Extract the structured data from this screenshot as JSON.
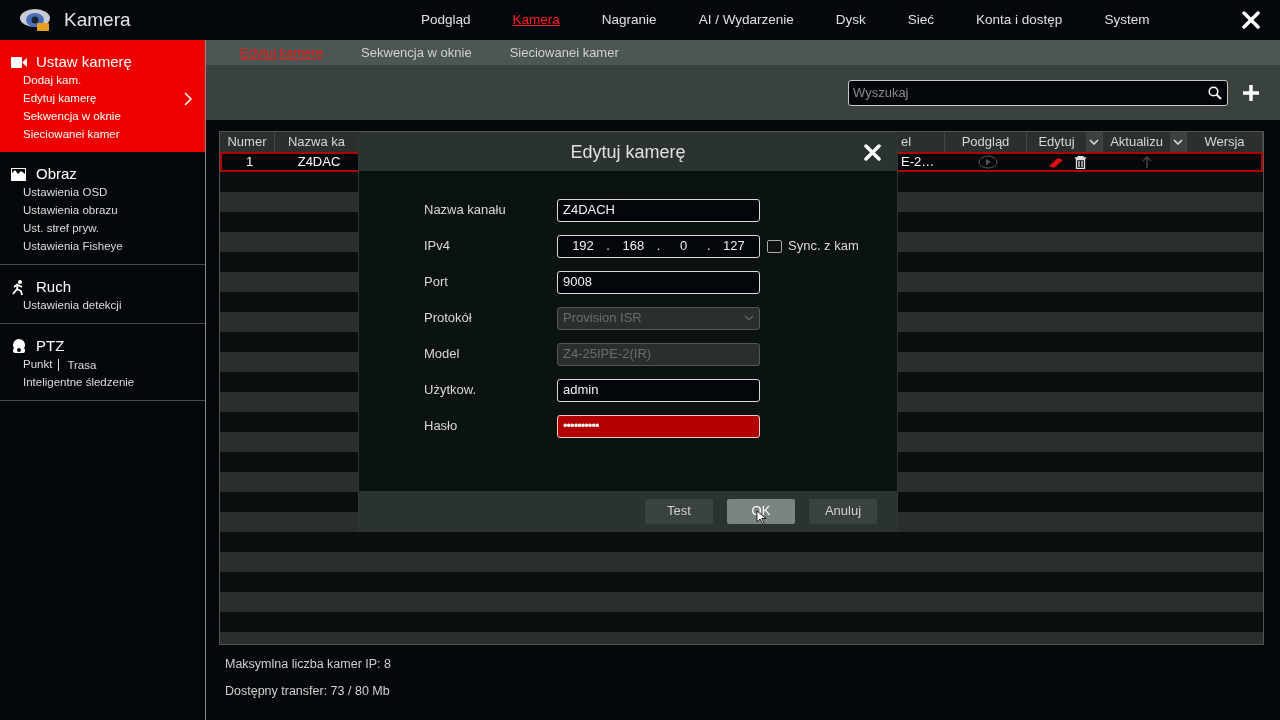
{
  "app": {
    "title": "Kamera"
  },
  "top_nav": [
    {
      "label": "Podgląd",
      "selected": false
    },
    {
      "label": "Kamera",
      "selected": true
    },
    {
      "label": "Nagranie",
      "selected": false
    },
    {
      "label": "AI / Wydarzenie",
      "selected": false
    },
    {
      "label": "Dysk",
      "selected": false
    },
    {
      "label": "Sieć",
      "selected": false
    },
    {
      "label": "Konta i dostęp",
      "selected": false
    },
    {
      "label": "System",
      "selected": false
    }
  ],
  "sidebar": {
    "sections": [
      {
        "title": "Ustaw kamerę",
        "selected": true,
        "rows": [
          [
            {
              "label": "Dodaj kam.",
              "selected": false
            }
          ],
          [
            {
              "label": "Edytuj kamerę",
              "selected": true
            }
          ],
          [
            {
              "label": "Sekwencja w oknie",
              "selected": false
            }
          ],
          [
            {
              "label": "Sieciowanei kamer",
              "selected": false
            }
          ]
        ]
      },
      {
        "title": "Obraz",
        "selected": false,
        "rows": [
          [
            {
              "label": "Ustawienia OSD",
              "selected": false
            }
          ],
          [
            {
              "label": "Ustawienia obrazu",
              "selected": false
            }
          ],
          [
            {
              "label": "Ust. stref pryw.",
              "selected": false
            }
          ],
          [
            {
              "label": "Ustawienia Fisheye",
              "selected": false
            }
          ]
        ]
      },
      {
        "title": "Ruch",
        "selected": false,
        "rows": [
          [
            {
              "label": "Ustawienia detekcji",
              "selected": false
            }
          ]
        ]
      },
      {
        "title": "PTZ",
        "selected": false,
        "rows": [
          [
            {
              "label": "Punkt",
              "selected": false
            },
            {
              "label": "Trasa",
              "selected": false
            }
          ],
          [
            {
              "label": "Inteligentne śledzenie",
              "selected": false
            }
          ]
        ]
      }
    ]
  },
  "subtabs": [
    {
      "label": "Edytuj kamerę",
      "selected": true
    },
    {
      "label": "Sekwencja w oknie",
      "selected": false
    },
    {
      "label": "Sieciowanei kamer",
      "selected": false
    }
  ],
  "search": {
    "placeholder": "Wyszukaj"
  },
  "table": {
    "columns": [
      {
        "label": "Numer",
        "kind": "text",
        "menu": false
      },
      {
        "label": "Nazwa ka",
        "kind": "text",
        "menu": false
      },
      {
        "label": "el",
        "kind": "text",
        "menu": false
      },
      {
        "label": "Podgląd",
        "kind": "preview",
        "menu": false
      },
      {
        "label": "Edytuj",
        "kind": "edit",
        "menu": true
      },
      {
        "label": "Aktualizu",
        "kind": "update",
        "menu": true
      },
      {
        "label": "Wersja",
        "kind": "version",
        "menu": false
      }
    ],
    "rows": [
      {
        "cells": [
          "1",
          "Z4DAC",
          "E-2…"
        ],
        "selected": true
      }
    ]
  },
  "info": [
    "Maksymlna liczba kamer IP: 8",
    "Dostępny transfer: 73 / 80 Mb"
  ],
  "dialog": {
    "title": "Edytuj kamerę",
    "fields": [
      {
        "label": "Nazwa kanału",
        "kind": "text",
        "value": "Z4DACH",
        "disabled": false,
        "focused": false
      },
      {
        "label": "IPv4",
        "kind": "ip",
        "octets": [
          "192",
          "168",
          "0",
          "127"
        ],
        "separator": ".",
        "disabled": false,
        "focused": false,
        "sync": {
          "label": "Sync. z kam",
          "checked": false
        }
      },
      {
        "label": "Port",
        "kind": "text",
        "value": "9008",
        "disabled": false,
        "focused": false
      },
      {
        "label": "Protokół",
        "kind": "select",
        "value": "Provision ISR",
        "disabled": true,
        "focused": false
      },
      {
        "label": "Model",
        "kind": "text",
        "value": "Z4-25IPE-2(IR)",
        "disabled": true,
        "focused": false
      },
      {
        "label": "Użytkow.",
        "kind": "text",
        "value": "admin",
        "disabled": false,
        "focused": false
      },
      {
        "label": "Hasło",
        "kind": "password",
        "value": "••••••••••",
        "disabled": false,
        "focused": true
      }
    ],
    "buttons": [
      {
        "label": "Test",
        "hovered": false
      },
      {
        "label": "OK",
        "hovered": true
      },
      {
        "label": "Anuluj",
        "hovered": false
      }
    ]
  }
}
